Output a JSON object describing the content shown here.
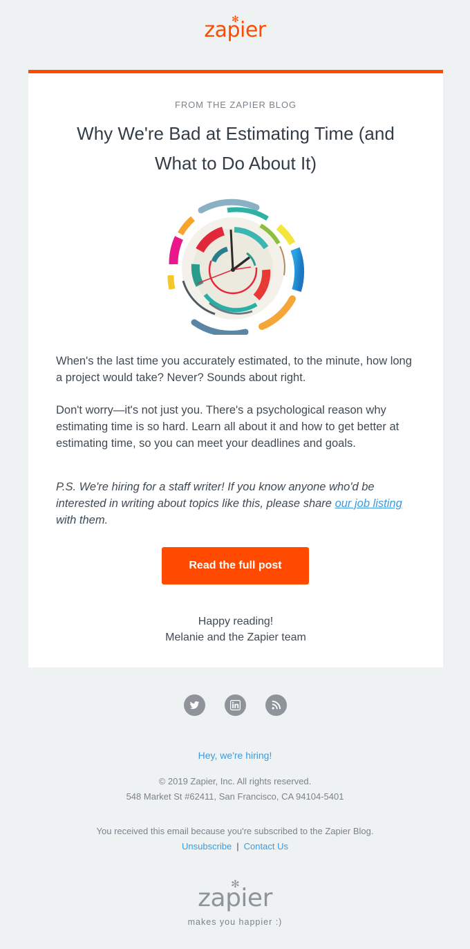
{
  "header": {
    "logo_text": "zapier",
    "logo_mark": "✻",
    "brand_color": "#ff4a00"
  },
  "card": {
    "eyebrow": "FROM THE ZAPIER BLOG",
    "headline": "Why We're Bad at Estimating Time (and What to Do About It)",
    "hero_icon": "clock-illustration-icon",
    "paragraph_1": "When's the last time you accurately estimated, to the minute, how long a project would take? Never? Sounds about right.",
    "paragraph_2": "Don't worry—it's not just you. There's a psychological reason why estimating time is so hard. Learn all about it and how to get better at estimating time, so you can meet your deadlines and goals.",
    "ps_before": "P.S. We're hiring for a staff writer! If you know anyone who'd be interested in writing about topics like this, please share ",
    "ps_link": "our job listing",
    "ps_after": " with them.",
    "cta_label": "Read the full post",
    "signoff_line_1": "Happy reading!",
    "signoff_line_2": "Melanie and the Zapier team"
  },
  "footer": {
    "social": [
      {
        "icon": "twitter-icon"
      },
      {
        "icon": "linkedin-icon"
      },
      {
        "icon": "rss-icon"
      }
    ],
    "hiring_link": "Hey, we're hiring!",
    "copyright": "© 2019 Zapier, Inc. All rights reserved.",
    "address": "548 Market St #62411, San Francisco, CA 94104-5401",
    "reason": "You received this email because you're subscribed to the Zapier Blog.",
    "unsubscribe": "Unsubscribe",
    "separator": "|",
    "contact": "Contact Us",
    "logo_text": "zapier",
    "tagline": "makes you happier :)",
    "link_color": "#3a9ae0"
  }
}
